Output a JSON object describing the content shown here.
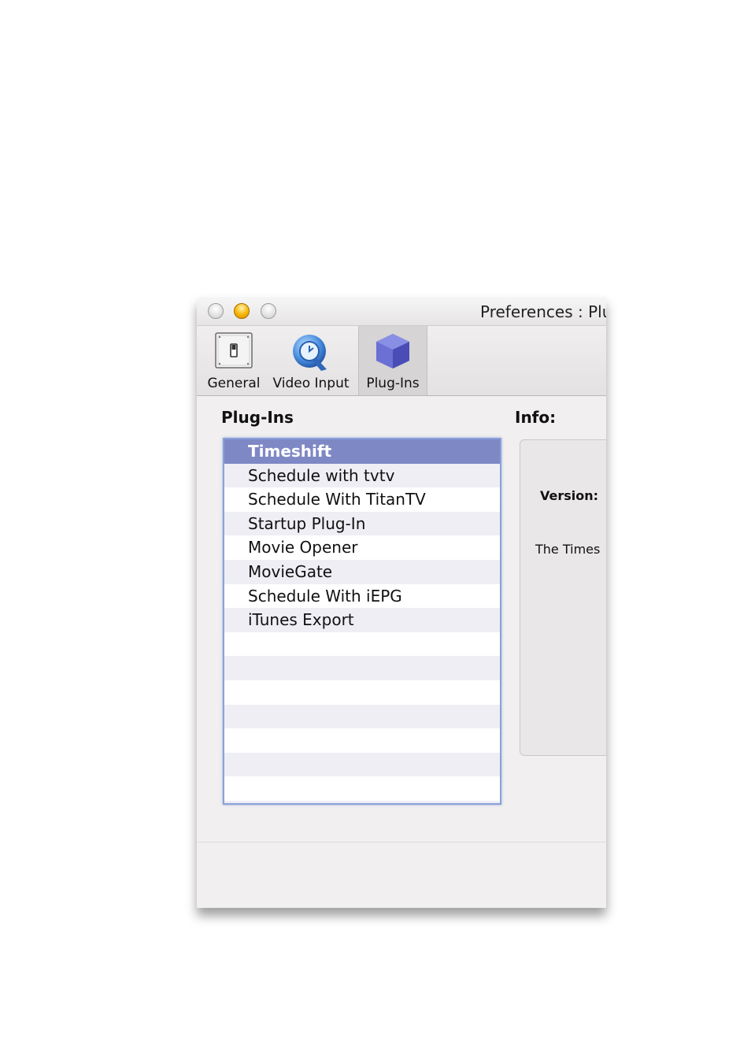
{
  "window": {
    "title": "Preferences : Plu"
  },
  "toolbar": {
    "items": [
      {
        "label": "General",
        "icon": "switch-icon"
      },
      {
        "label": "Video Input",
        "icon": "quicktime-icon"
      },
      {
        "label": "Plug-Ins",
        "icon": "cube-icon",
        "selected": true
      }
    ]
  },
  "plugins": {
    "heading": "Plug-Ins",
    "items": [
      "Timeshift",
      "Schedule with tvtv",
      "Schedule With TitanTV",
      "Startup Plug-In",
      "Movie Opener",
      "MovieGate",
      "Schedule With iEPG",
      "iTunes Export"
    ],
    "selected_index": 0
  },
  "info": {
    "heading": "Info:",
    "version_label": "Version:",
    "description": "The Times"
  },
  "colors": {
    "selection": "#7e88c4",
    "list_focus_ring": "#8aa1d9",
    "stripe": "#eeeef4",
    "window_bg": "#f1efef"
  }
}
